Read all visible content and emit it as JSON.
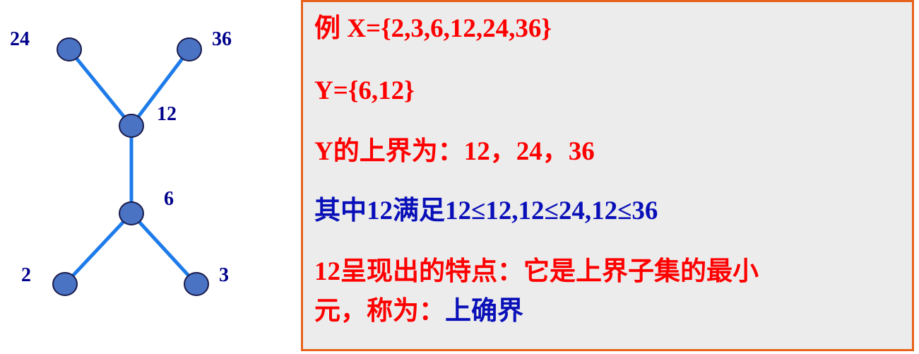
{
  "diagram": {
    "nodes": [
      {
        "id": "24",
        "label": "24"
      },
      {
        "id": "36",
        "label": "36"
      },
      {
        "id": "12",
        "label": "12"
      },
      {
        "id": "6",
        "label": "6"
      },
      {
        "id": "2",
        "label": "2"
      },
      {
        "id": "3",
        "label": "3"
      }
    ],
    "edges": [
      [
        "24",
        "12"
      ],
      [
        "36",
        "12"
      ],
      [
        "12",
        "6"
      ],
      [
        "6",
        "2"
      ],
      [
        "6",
        "3"
      ]
    ],
    "node_fill": "#4a73c4",
    "edge_color": "#1e7bea",
    "label_color": "#00008b"
  },
  "textbox": {
    "border_color": "#e8621c",
    "lines": {
      "l1": "例 X={2,3,6,12,24,36}",
      "l2": "Y={6,12}",
      "l3": "Y的上界为：12，24，36",
      "l4": "其中12满足12≤12,12≤24,12≤36",
      "l5": "12呈现出的特点：它是上界子集的最小",
      "l6a": "元，称为：",
      "l6b": "上确界"
    }
  }
}
